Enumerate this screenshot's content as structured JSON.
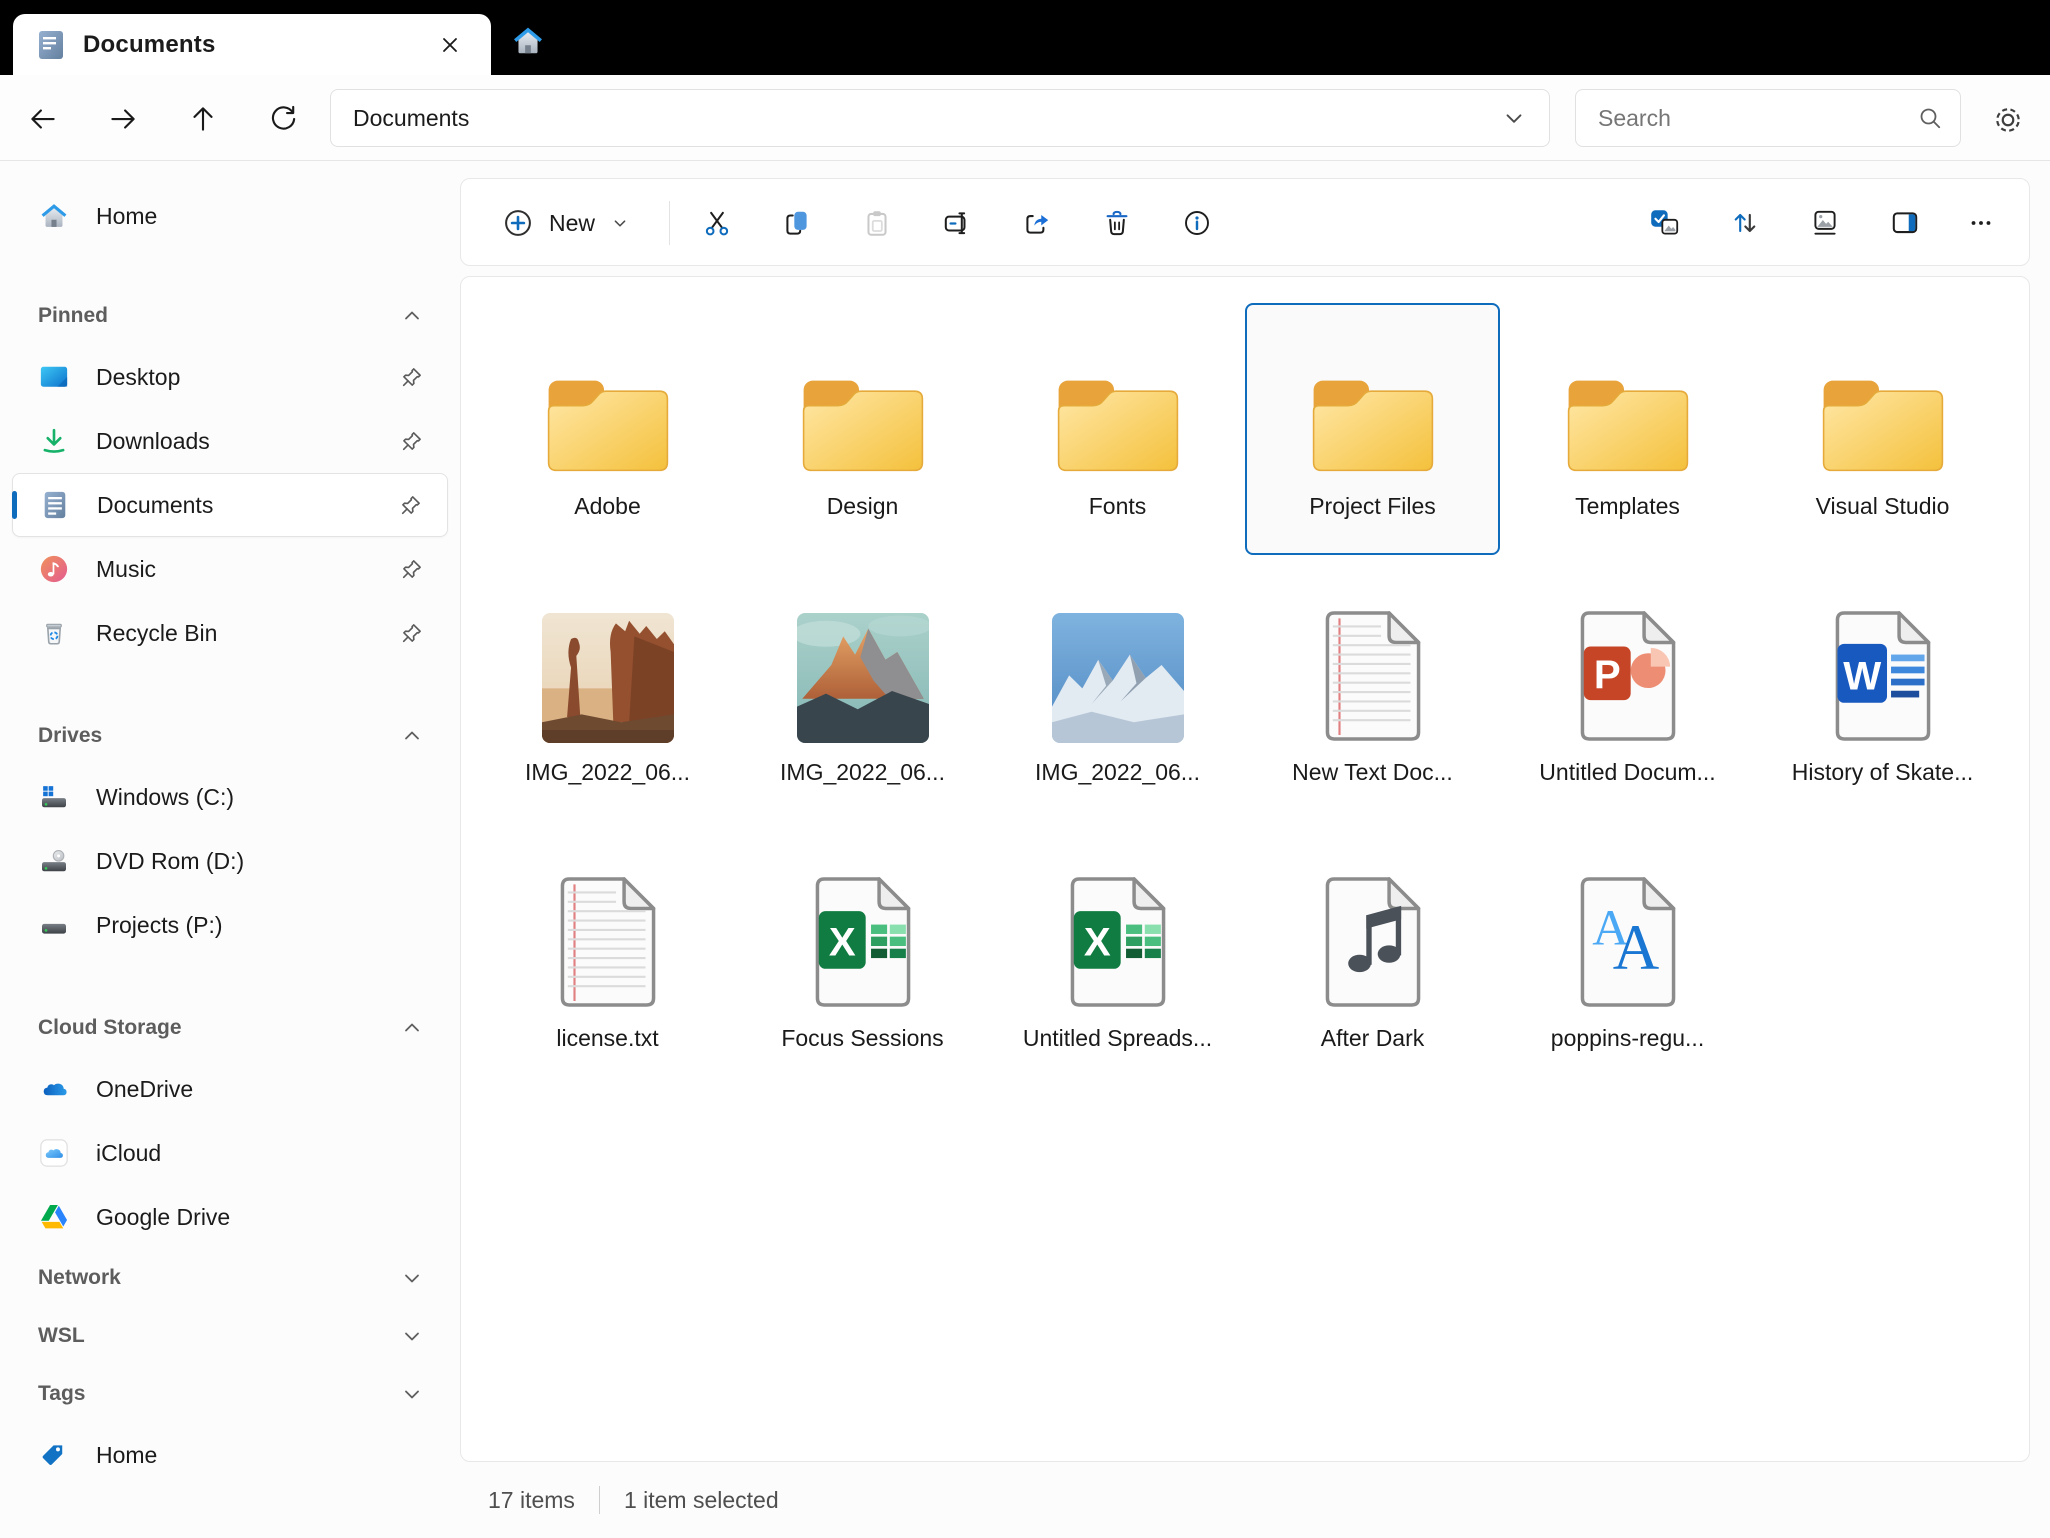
{
  "titlebar": {
    "tab_title": "Documents"
  },
  "nav": {
    "address": "Documents",
    "search_placeholder": "Search"
  },
  "toolbar": {
    "new_label": "New"
  },
  "sidebar": {
    "home": {
      "label": "Home"
    },
    "sections": [
      {
        "label": "Pinned",
        "expanded": true
      },
      {
        "label": "Drives",
        "expanded": true
      },
      {
        "label": "Cloud Storage",
        "expanded": true
      },
      {
        "label": "Network",
        "expanded": false
      },
      {
        "label": "WSL",
        "expanded": false
      },
      {
        "label": "Tags",
        "expanded": false
      }
    ],
    "pinned": [
      {
        "label": "Desktop",
        "pinned": true
      },
      {
        "label": "Downloads",
        "pinned": true
      },
      {
        "label": "Documents",
        "pinned": true,
        "selected": true
      },
      {
        "label": "Music",
        "pinned": true
      },
      {
        "label": "Recycle Bin",
        "pinned": true
      }
    ],
    "drives": [
      {
        "label": "Windows (C:)"
      },
      {
        "label": "DVD Rom (D:)"
      },
      {
        "label": "Projects (P:)"
      }
    ],
    "cloud": [
      {
        "label": "OneDrive"
      },
      {
        "label": "iCloud"
      },
      {
        "label": "Google Drive"
      }
    ],
    "tags": [
      {
        "label": "Home"
      }
    ]
  },
  "files": {
    "items": [
      {
        "label": "Adobe",
        "type": "folder"
      },
      {
        "label": "Design",
        "type": "folder"
      },
      {
        "label": "Fonts",
        "type": "folder"
      },
      {
        "label": "Project Files",
        "type": "folder",
        "selected": true
      },
      {
        "label": "Templates",
        "type": "folder"
      },
      {
        "label": "Visual Studio",
        "type": "folder"
      },
      {
        "label": "IMG_2022_06...",
        "type": "image"
      },
      {
        "label": "IMG_2022_06...",
        "type": "image"
      },
      {
        "label": "IMG_2022_06...",
        "type": "image"
      },
      {
        "label": "New Text Doc...",
        "type": "text"
      },
      {
        "label": "Untitled Docum...",
        "type": "powerpoint"
      },
      {
        "label": "History of Skate...",
        "type": "word"
      },
      {
        "label": "license.txt",
        "type": "text"
      },
      {
        "label": "Focus Sessions",
        "type": "excel"
      },
      {
        "label": "Untitled Spreads...",
        "type": "excel"
      },
      {
        "label": "After Dark",
        "type": "audio"
      },
      {
        "label": "poppins-regu...",
        "type": "font"
      }
    ]
  },
  "status": {
    "count": "17 items",
    "selected": "1 item selected"
  },
  "colors": {
    "accent": "#0F6CBD",
    "titlebar": "#000000",
    "folder_tab": "#E8A33B",
    "folder_body": "#F6C53F",
    "excel_green": "#107C41",
    "word_blue": "#1859C0",
    "powerpoint_red": "#C64527",
    "selection_border": "#0F6CBD"
  },
  "icons": {
    "tab": [
      "document-icon",
      "close-icon"
    ],
    "titlebar": [
      "home-tab-icon"
    ],
    "nav": [
      "back-icon",
      "forward-icon",
      "up-icon",
      "refresh-icon",
      "chevron-down-icon",
      "search-icon",
      "gear-icon"
    ],
    "toolbar": [
      "plus-circle-icon",
      "cut-icon",
      "copy-icon",
      "paste-icon",
      "rename-icon",
      "share-icon",
      "delete-icon",
      "info-icon",
      "select-all-icon",
      "sort-icon",
      "view-icon",
      "panel-icon",
      "more-icon"
    ],
    "sidebar": [
      "home-icon",
      "desktop-icon",
      "downloads-icon",
      "documents-icon",
      "music-icon",
      "recycle-bin-icon",
      "drive-windows-icon",
      "drive-dvd-icon",
      "drive-icon",
      "onedrive-icon",
      "icloud-icon",
      "google-drive-icon",
      "tag-icon",
      "pin-icon",
      "chevron-up-icon",
      "chevron-down-icon"
    ]
  }
}
